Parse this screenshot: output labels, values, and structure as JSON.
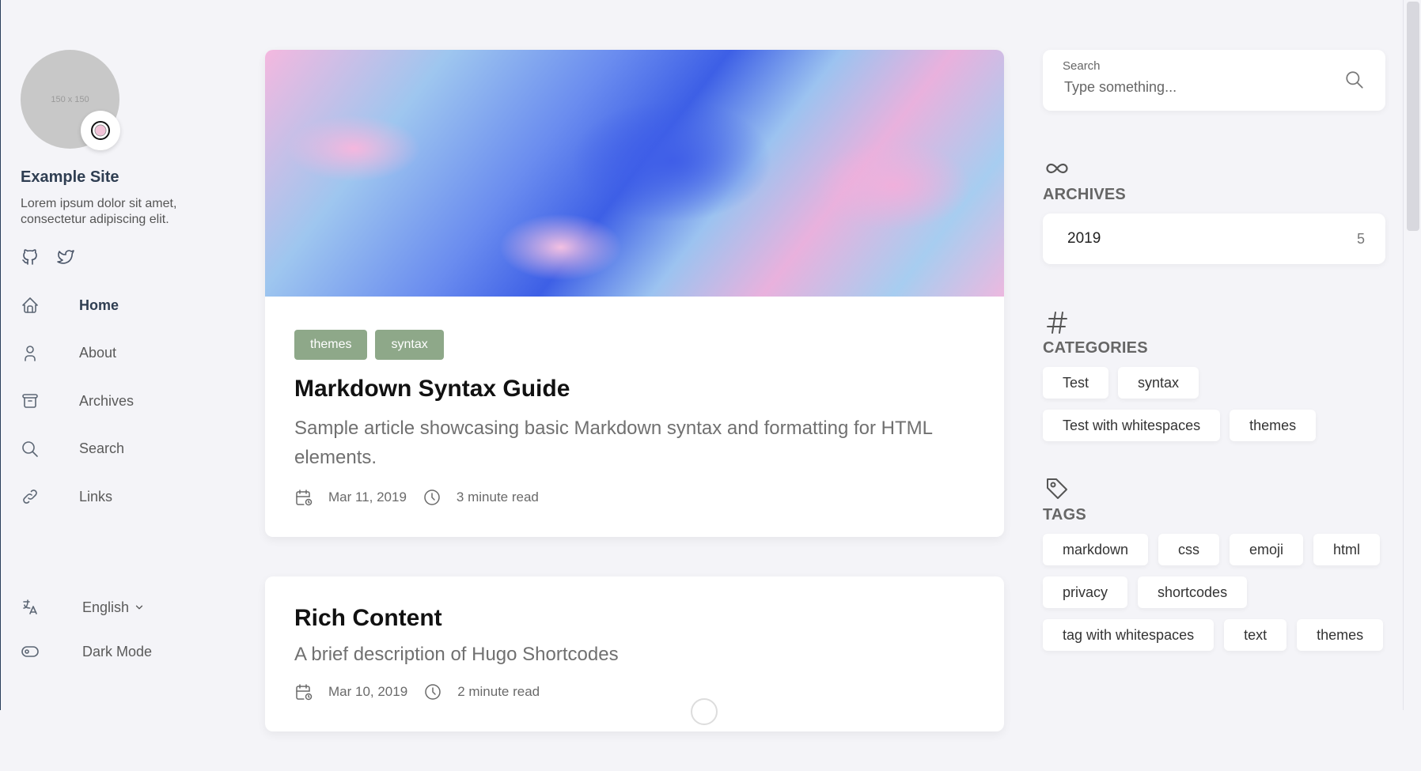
{
  "site": {
    "avatar_placeholder": "150 x 150",
    "name": "Example Site",
    "description": "Lorem ipsum dolor sit amet, consectetur adipiscing elit."
  },
  "nav": {
    "items": [
      {
        "label": "Home",
        "icon": "home-icon"
      },
      {
        "label": "About",
        "icon": "user-icon"
      },
      {
        "label": "Archives",
        "icon": "archive-icon"
      },
      {
        "label": "Search",
        "icon": "search-icon"
      },
      {
        "label": "Links",
        "icon": "link-icon"
      }
    ]
  },
  "bottom": {
    "language": "English",
    "dark_mode": "Dark Mode"
  },
  "posts": [
    {
      "tags": [
        "themes",
        "syntax"
      ],
      "title": "Markdown Syntax Guide",
      "description": "Sample article showcasing basic Markdown syntax and formatting for HTML elements.",
      "date": "Mar 11, 2019",
      "read_time": "3 minute read"
    },
    {
      "title": "Rich Content",
      "description": "A brief description of Hugo Shortcodes",
      "date": "Mar 10, 2019",
      "read_time": "2 minute read"
    }
  ],
  "search": {
    "label": "Search",
    "placeholder": "Type something..."
  },
  "archives": {
    "title": "ARCHIVES",
    "year": "2019",
    "count": "5"
  },
  "categories": {
    "title": "CATEGORIES",
    "items": [
      "Test",
      "syntax",
      "Test with whitespaces",
      "themes"
    ]
  },
  "tags": {
    "title": "TAGS",
    "items": [
      "markdown",
      "css",
      "emoji",
      "html",
      "privacy",
      "shortcodes",
      "tag with whitespaces",
      "text",
      "themes"
    ]
  },
  "colors": {
    "accent_tag": "#8ea889",
    "page_bg": "#f4f4f8"
  }
}
